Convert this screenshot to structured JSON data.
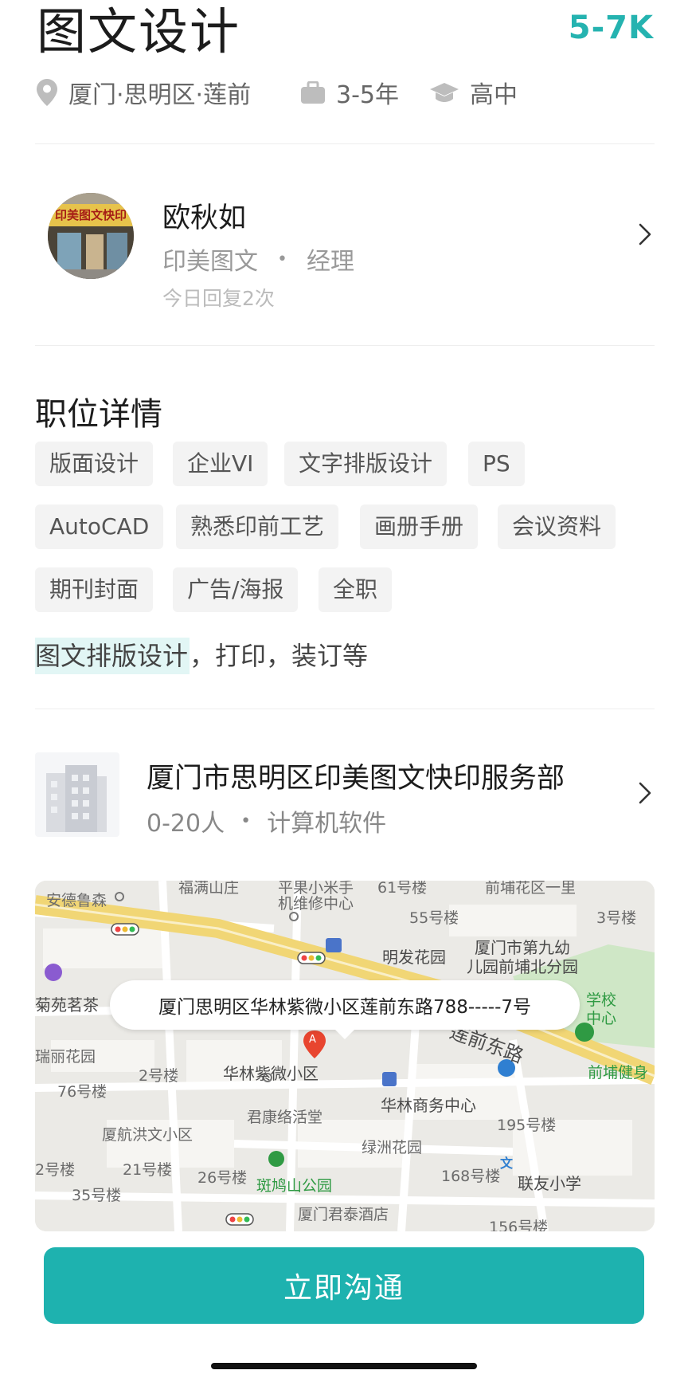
{
  "header": {
    "title": "图文设计",
    "salary": "5-7K",
    "location": "厦门·思明区·莲前",
    "experience": "3-5年",
    "education": "高中",
    "icons": [
      "location-pin-icon",
      "briefcase-icon",
      "graduation-cap-icon"
    ]
  },
  "recruiter": {
    "name": "欧秋如",
    "company_short": "印美图文",
    "separator": "•",
    "role": "经理",
    "reply_note": "今日回复2次",
    "avatar_sign_text": "印美图文快印"
  },
  "details": {
    "title": "职位详情",
    "tags": [
      "版面设计",
      "企业VI",
      "文字排版设计",
      "PS",
      "AutoCAD",
      "熟悉印前工艺",
      "画册手册",
      "会议资料",
      "期刊封面",
      "广告/海报",
      "全职"
    ],
    "desc_highlight": "图文排版设计",
    "desc_rest": "，打印，装订等"
  },
  "company": {
    "name": "厦门市思明区印美图文快印服务部",
    "size": "0-20人",
    "separator": "•",
    "industry": "计算机软件"
  },
  "map": {
    "address": "厦门思明区华林紫微小区莲前东路788-----7号",
    "labels": {
      "l1": "安德鲁森",
      "l2": "机维修中心",
      "l3": "55号楼",
      "l4": "3号楼",
      "l5": "明发花园",
      "l6": "厦门市第九幼",
      "l7": "儿园前埔北分园",
      "l8": "菊苑茗茶",
      "l9": "瑞丽花园",
      "l10": "2号楼",
      "l11": "华林紫微小区",
      "l12": "莲前东路",
      "l13": "前埔健身",
      "l14": "76号楼",
      "l15": "华林商务中心",
      "l16": "君康络活堂",
      "l17": "195号楼",
      "l18": "厦航洪文小区",
      "l19": "绿洲花园",
      "l20": "2号楼",
      "l21": "21号楼",
      "l22": "26号楼",
      "l23": "168号楼",
      "l24": "斑鸠山公园",
      "l25": "联友小学",
      "l26": "35号楼",
      "l27": "厦门君泰酒店",
      "l28": "156号楼",
      "l29": "平果小米手",
      "l30": "61号楼",
      "l31": "前埔花区一里",
      "l32": "福满山庄",
      "l33": "学校",
      "l34": "中心"
    },
    "marker_letter": "A",
    "school_icon_glyph": "文"
  },
  "footer": {
    "cta_label": "立即沟通"
  }
}
